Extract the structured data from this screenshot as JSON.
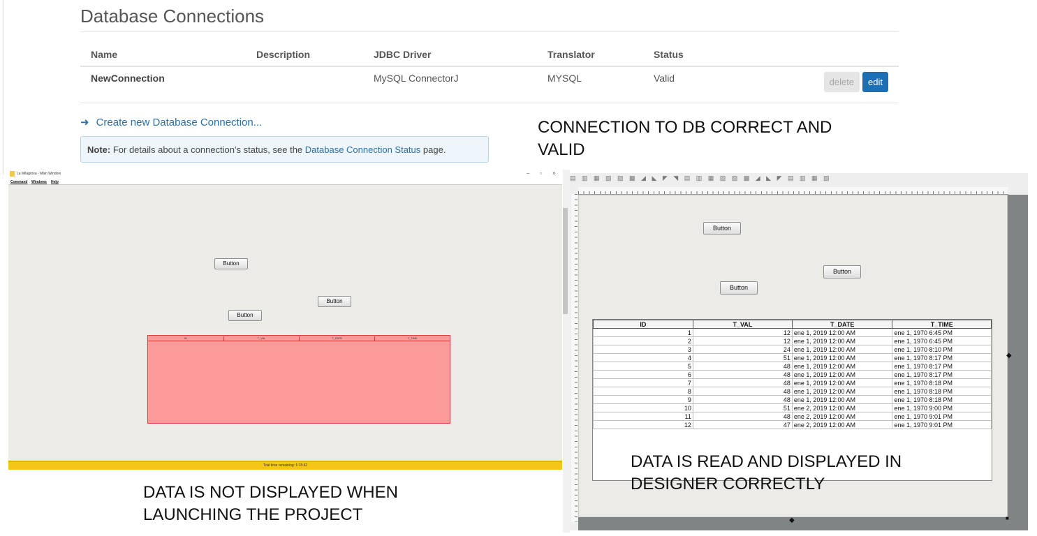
{
  "page": {
    "title": "Database Connections",
    "table": {
      "headers": [
        "Name",
        "Description",
        "JDBC Driver",
        "Translator",
        "Status"
      ],
      "rows": [
        {
          "name": "NewConnection",
          "description": "",
          "driver": "MySQL ConnectorJ",
          "translator": "MYSQL",
          "status": "Valid"
        }
      ],
      "delete_label": "delete",
      "edit_label": "edit"
    },
    "create_link": "Create new Database Connection...",
    "note": {
      "label": "Note:",
      "text_before": "For details about a connection's status, see the",
      "link": "Database Connection Status",
      "text_after": "page."
    }
  },
  "captions": {
    "top_right_line1": "CONNECTION TO DB CORRECT AND",
    "top_right_line2": "VALID",
    "bottom_left_line1": "DATA IS NOT DISPLAYED WHEN",
    "bottom_left_line2": "LAUNCHING THE PROJECT",
    "bottom_right_line1": "DATA IS READ AND DISPLAYED IN",
    "bottom_right_line2": "DESIGNER CORRECTLY"
  },
  "runtime_window": {
    "title": "La Milagrosa - Main Window",
    "controls": {
      "minimize": "–",
      "maximize": "▫",
      "close": "×"
    },
    "menu": [
      "Command",
      "Windows",
      "Help"
    ],
    "buttons": [
      "Button",
      "Button",
      "Button"
    ],
    "table_headers": [
      "ID",
      "T_VAL",
      "T_DATE",
      "T_TIME"
    ],
    "trial_text": "Trial time remaining: 1:15:42"
  },
  "designer": {
    "buttons": [
      "Button",
      "Button",
      "Button"
    ],
    "table": {
      "headers": [
        "ID",
        "T_VAL",
        "T_DATE",
        "T_TIME"
      ],
      "rows": [
        [
          "1",
          "12",
          "ene 1, 2019 12:00 AM",
          "ene 1, 1970 6:45 PM"
        ],
        [
          "2",
          "12",
          "ene 1, 2019 12:00 AM",
          "ene 1, 1970 6:45 PM"
        ],
        [
          "3",
          "24",
          "ene 1, 2019 12:00 AM",
          "ene 1, 1970 8:10 PM"
        ],
        [
          "4",
          "51",
          "ene 1, 2019 12:00 AM",
          "ene 1, 1970 8:17 PM"
        ],
        [
          "5",
          "48",
          "ene 1, 2019 12:00 AM",
          "ene 1, 1970 8:17 PM"
        ],
        [
          "6",
          "48",
          "ene 1, 2019 12:00 AM",
          "ene 1, 1970 8:17 PM"
        ],
        [
          "7",
          "48",
          "ene 1, 2019 12:00 AM",
          "ene 1, 1970 8:18 PM"
        ],
        [
          "8",
          "48",
          "ene 1, 2019 12:00 AM",
          "ene 1, 1970 8:18 PM"
        ],
        [
          "9",
          "48",
          "ene 1, 2019 12:00 AM",
          "ene 1, 1970 8:18 PM"
        ],
        [
          "10",
          "51",
          "ene 2, 2019 12:00 AM",
          "ene 1, 1970 9:00 PM"
        ],
        [
          "11",
          "48",
          "ene 2, 2019 12:00 AM",
          "ene 1, 1970 9:01 PM"
        ],
        [
          "12",
          "47",
          "ene 2, 2019 12:00 AM",
          "ene 1, 1970 9:01 PM"
        ]
      ]
    }
  }
}
